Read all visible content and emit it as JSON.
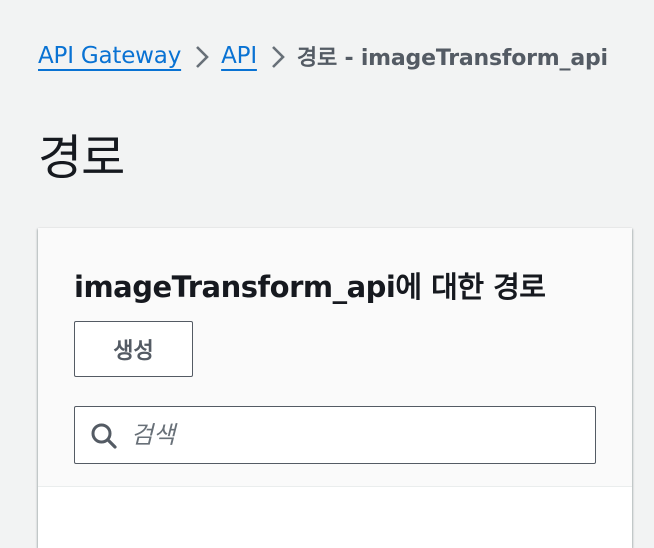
{
  "breadcrumb": {
    "items": [
      {
        "label": "API Gateway"
      },
      {
        "label": "API"
      }
    ],
    "current": "경로 - imageTransform_api"
  },
  "page": {
    "title": "경로"
  },
  "panel": {
    "title": "imageTransform_api에 대한 경로",
    "create_label": "생성",
    "search": {
      "placeholder": "검색",
      "value": ""
    }
  },
  "colors": {
    "link": "#0972d3",
    "background": "#f2f3f3",
    "text": "#16191f",
    "muted": "#545b64"
  },
  "icons": {
    "separator": "chevron-right-icon",
    "search": "search-icon"
  }
}
